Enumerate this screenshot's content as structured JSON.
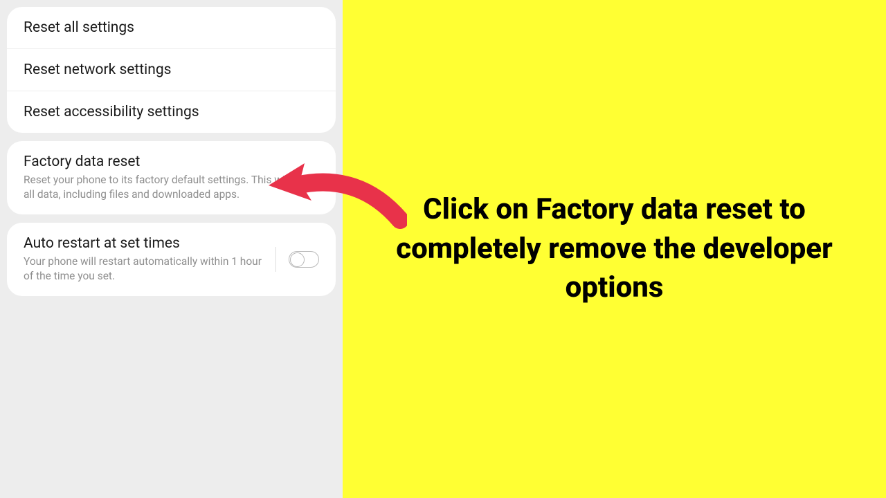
{
  "settings": {
    "group1": [
      {
        "title": "Reset all settings"
      },
      {
        "title": "Reset network settings"
      },
      {
        "title": "Reset accessibility settings"
      }
    ],
    "factory": {
      "title": "Factory data reset",
      "sub": "Reset your phone to its factory default settings. This will erase all data, including files and downloaded apps."
    },
    "autoRestart": {
      "title": "Auto restart at set times",
      "sub": "Your phone will restart automatically within 1 hour of the time you set."
    }
  },
  "instruction": "Click on Factory data reset to completely remove the developer options"
}
